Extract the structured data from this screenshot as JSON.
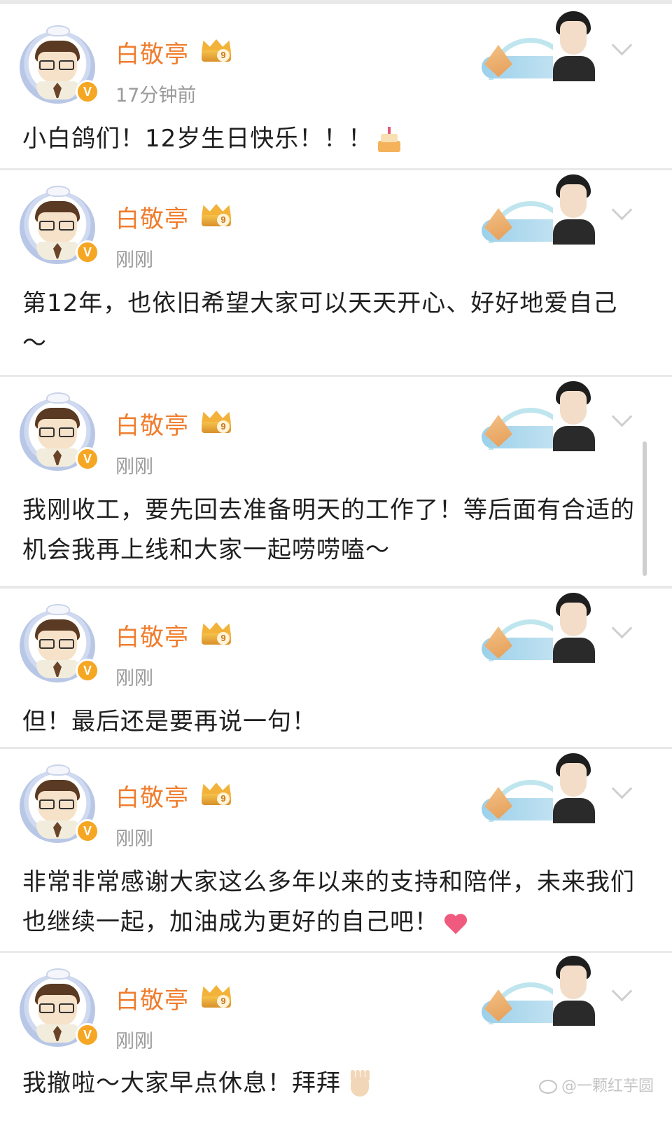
{
  "posts": [
    {
      "user": "白敬亭",
      "time": "17分钟前",
      "text": "小白鸽们！12岁生日快乐！！！",
      "emoji": "birthday-cake"
    },
    {
      "user": "白敬亭",
      "time": "刚刚",
      "text": "第12年，也依旧希望大家可以天天开心、好好地爱自己～",
      "emoji": ""
    },
    {
      "user": "白敬亭",
      "time": "刚刚",
      "text": "我刚收工，要先回去准备明天的工作了！等后面有合适的机会我再上线和大家一起唠唠嗑～",
      "emoji": ""
    },
    {
      "user": "白敬亭",
      "time": "刚刚",
      "text": "但！最后还是要再说一句！",
      "emoji": ""
    },
    {
      "user": "白敬亭",
      "time": "刚刚",
      "text": "非常非常感谢大家这么多年以来的支持和陪伴，未来我们也继续一起，加油成为更好的自己吧！",
      "emoji": "heart"
    },
    {
      "user": "白敬亭",
      "time": "刚刚",
      "text": "我撤啦～大家早点休息！拜拜",
      "emoji": "waving-hand"
    }
  ],
  "badge": {
    "crown_level": "9",
    "verified": "V"
  },
  "watermark": "@一颗红芋圆",
  "colors": {
    "username": "#f07d2e",
    "timestamp": "#9a9a9a",
    "background": "#e9e9e9",
    "card": "#ffffff"
  }
}
